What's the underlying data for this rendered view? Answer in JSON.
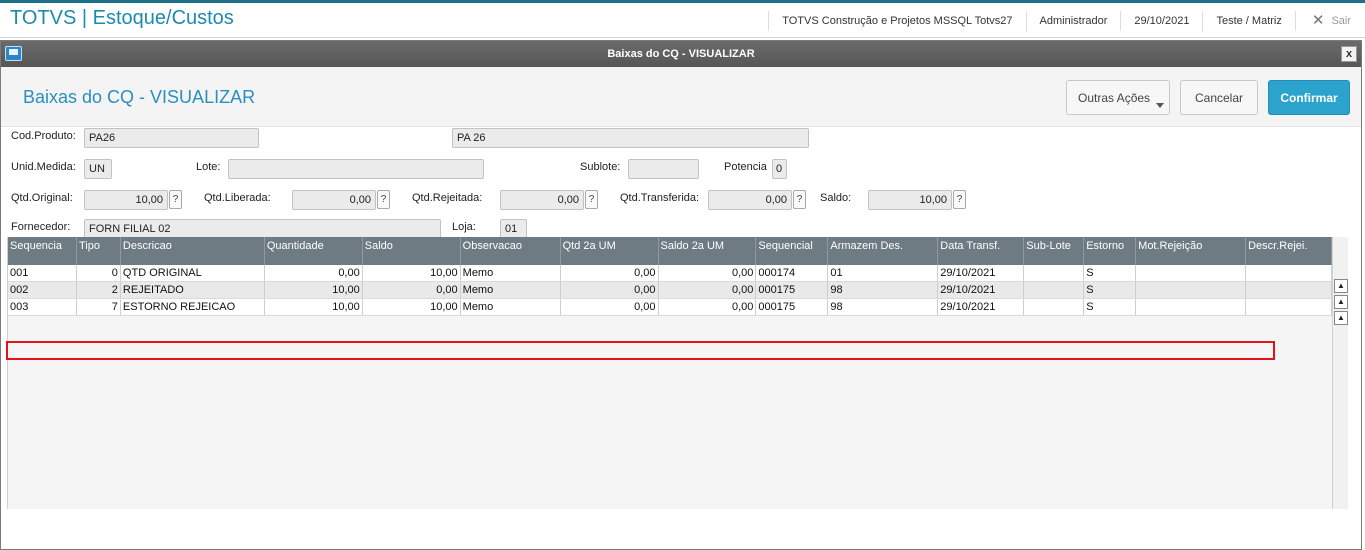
{
  "app": {
    "title": "TOTVS | Estoque/Custos",
    "company": "TOTVS Construção e Projetos MSSQL Totvs27",
    "user": "Administrador",
    "date": "29/10/2021",
    "branch": "Teste / Matriz",
    "exit_label": "Sair"
  },
  "window": {
    "title": "Baixas do CQ - VISUALIZAR",
    "close": "x",
    "page_title": "Baixas do CQ - VISUALIZAR"
  },
  "actions": {
    "more": "Outras Ações",
    "cancel": "Cancelar",
    "confirm": "Confirmar"
  },
  "form": {
    "cod_produto_label": "Cod.Produto:",
    "cod_produto": "PA26",
    "descricao": "PA 26",
    "unid_medida_label": "Unid.Medida:",
    "unid_medida": "UN",
    "lote_label": "Lote:",
    "lote": "",
    "sublote_label": "Sublote:",
    "sublote": "",
    "potencia_label": "Potencia",
    "potencia": "0",
    "qtd_original_label": "Qtd.Original:",
    "qtd_original": "10,00",
    "qtd_liberada_label": "Qtd.Liberada:",
    "qtd_liberada": "0,00",
    "qtd_rejeitada_label": "Qtd.Rejeitada:",
    "qtd_rejeitada": "0,00",
    "qtd_transferida_label": "Qtd.Transferida:",
    "qtd_transferida": "0,00",
    "saldo_label": "Saldo:",
    "saldo": "10,00",
    "fornecedor_label": "Fornecedor:",
    "fornecedor": "FORN FILIAL 02",
    "loja_label": "Loja:",
    "loja": "01",
    "help": "?"
  },
  "grid": {
    "columns": [
      "Sequencia",
      "Tipo",
      "Descricao",
      "Quantidade",
      "Saldo",
      "Observacao",
      "Qtd 2a UM",
      "Saldo 2a UM",
      "Sequencial",
      "Armazem Des.",
      "Data Transf.",
      "Sub-Lote",
      "Estorno",
      "Mot.Rejeição",
      "Descr.Rejei."
    ],
    "rows": [
      [
        "001",
        "0",
        "QTD ORIGINAL",
        "0,00",
        "10,00",
        "Memo",
        "0,00",
        "0,00",
        "000174",
        "01",
        "29/10/2021",
        "",
        "S",
        "",
        ""
      ],
      [
        "002",
        "2",
        "REJEITADO",
        "10,00",
        "0,00",
        "Memo",
        "0,00",
        "0,00",
        "000175",
        "98",
        "29/10/2021",
        "",
        "S",
        "",
        ""
      ],
      [
        "003",
        "7",
        "ESTORNO REJEICAO",
        "10,00",
        "10,00",
        "Memo",
        "0,00",
        "0,00",
        "000175",
        "98",
        "29/10/2021",
        "",
        "S",
        "",
        ""
      ]
    ],
    "highlight_color": "#e0121a"
  },
  "icons": [
    "window-icon",
    "close-icon",
    "exit-icon",
    "help-icon",
    "scroll-top-icon",
    "scroll-up-icon"
  ]
}
